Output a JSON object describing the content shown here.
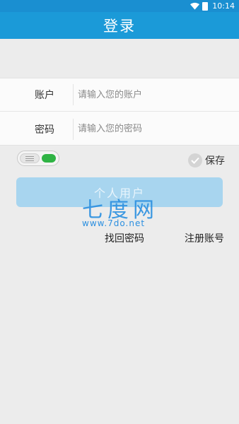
{
  "status_bar": {
    "time": "10:14",
    "icons": [
      "wifi-icon",
      "battery-icon"
    ]
  },
  "header": {
    "title": "登录"
  },
  "form": {
    "account_label": "账户",
    "account_placeholder": "请输入您的账户",
    "account_value": "",
    "password_label": "密码",
    "password_placeholder": "请输入您的密码",
    "password_value": ""
  },
  "options": {
    "toggle_on": true,
    "save_label": "保存",
    "save_checked": false
  },
  "login_button": {
    "label": "个人用户"
  },
  "links": {
    "forgot_password": "找回密码",
    "register": "注册账号"
  },
  "watermark": {
    "text": "七度网",
    "url": "www.7do.net"
  },
  "colors": {
    "primary": "#1b9ad8",
    "button": "#a8d5ef",
    "toggle_on": "#2fb344",
    "background": "#ececec"
  }
}
